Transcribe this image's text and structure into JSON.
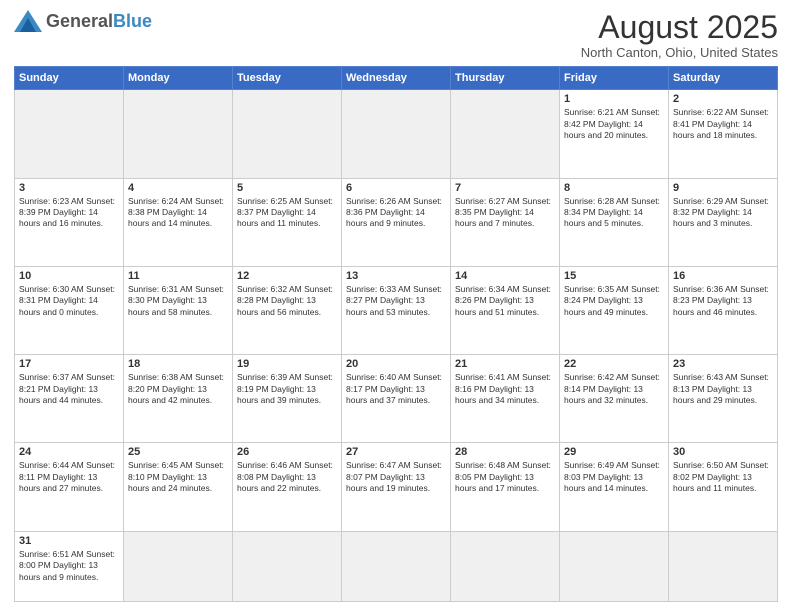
{
  "header": {
    "logo_general": "General",
    "logo_blue": "Blue",
    "month_title": "August 2025",
    "location": "North Canton, Ohio, United States"
  },
  "days_of_week": [
    "Sunday",
    "Monday",
    "Tuesday",
    "Wednesday",
    "Thursday",
    "Friday",
    "Saturday"
  ],
  "weeks": [
    [
      {
        "day": "",
        "info": ""
      },
      {
        "day": "",
        "info": ""
      },
      {
        "day": "",
        "info": ""
      },
      {
        "day": "",
        "info": ""
      },
      {
        "day": "",
        "info": ""
      },
      {
        "day": "1",
        "info": "Sunrise: 6:21 AM\nSunset: 8:42 PM\nDaylight: 14 hours and 20 minutes."
      },
      {
        "day": "2",
        "info": "Sunrise: 6:22 AM\nSunset: 8:41 PM\nDaylight: 14 hours and 18 minutes."
      }
    ],
    [
      {
        "day": "3",
        "info": "Sunrise: 6:23 AM\nSunset: 8:39 PM\nDaylight: 14 hours and 16 minutes."
      },
      {
        "day": "4",
        "info": "Sunrise: 6:24 AM\nSunset: 8:38 PM\nDaylight: 14 hours and 14 minutes."
      },
      {
        "day": "5",
        "info": "Sunrise: 6:25 AM\nSunset: 8:37 PM\nDaylight: 14 hours and 11 minutes."
      },
      {
        "day": "6",
        "info": "Sunrise: 6:26 AM\nSunset: 8:36 PM\nDaylight: 14 hours and 9 minutes."
      },
      {
        "day": "7",
        "info": "Sunrise: 6:27 AM\nSunset: 8:35 PM\nDaylight: 14 hours and 7 minutes."
      },
      {
        "day": "8",
        "info": "Sunrise: 6:28 AM\nSunset: 8:34 PM\nDaylight: 14 hours and 5 minutes."
      },
      {
        "day": "9",
        "info": "Sunrise: 6:29 AM\nSunset: 8:32 PM\nDaylight: 14 hours and 3 minutes."
      }
    ],
    [
      {
        "day": "10",
        "info": "Sunrise: 6:30 AM\nSunset: 8:31 PM\nDaylight: 14 hours and 0 minutes."
      },
      {
        "day": "11",
        "info": "Sunrise: 6:31 AM\nSunset: 8:30 PM\nDaylight: 13 hours and 58 minutes."
      },
      {
        "day": "12",
        "info": "Sunrise: 6:32 AM\nSunset: 8:28 PM\nDaylight: 13 hours and 56 minutes."
      },
      {
        "day": "13",
        "info": "Sunrise: 6:33 AM\nSunset: 8:27 PM\nDaylight: 13 hours and 53 minutes."
      },
      {
        "day": "14",
        "info": "Sunrise: 6:34 AM\nSunset: 8:26 PM\nDaylight: 13 hours and 51 minutes."
      },
      {
        "day": "15",
        "info": "Sunrise: 6:35 AM\nSunset: 8:24 PM\nDaylight: 13 hours and 49 minutes."
      },
      {
        "day": "16",
        "info": "Sunrise: 6:36 AM\nSunset: 8:23 PM\nDaylight: 13 hours and 46 minutes."
      }
    ],
    [
      {
        "day": "17",
        "info": "Sunrise: 6:37 AM\nSunset: 8:21 PM\nDaylight: 13 hours and 44 minutes."
      },
      {
        "day": "18",
        "info": "Sunrise: 6:38 AM\nSunset: 8:20 PM\nDaylight: 13 hours and 42 minutes."
      },
      {
        "day": "19",
        "info": "Sunrise: 6:39 AM\nSunset: 8:19 PM\nDaylight: 13 hours and 39 minutes."
      },
      {
        "day": "20",
        "info": "Sunrise: 6:40 AM\nSunset: 8:17 PM\nDaylight: 13 hours and 37 minutes."
      },
      {
        "day": "21",
        "info": "Sunrise: 6:41 AM\nSunset: 8:16 PM\nDaylight: 13 hours and 34 minutes."
      },
      {
        "day": "22",
        "info": "Sunrise: 6:42 AM\nSunset: 8:14 PM\nDaylight: 13 hours and 32 minutes."
      },
      {
        "day": "23",
        "info": "Sunrise: 6:43 AM\nSunset: 8:13 PM\nDaylight: 13 hours and 29 minutes."
      }
    ],
    [
      {
        "day": "24",
        "info": "Sunrise: 6:44 AM\nSunset: 8:11 PM\nDaylight: 13 hours and 27 minutes."
      },
      {
        "day": "25",
        "info": "Sunrise: 6:45 AM\nSunset: 8:10 PM\nDaylight: 13 hours and 24 minutes."
      },
      {
        "day": "26",
        "info": "Sunrise: 6:46 AM\nSunset: 8:08 PM\nDaylight: 13 hours and 22 minutes."
      },
      {
        "day": "27",
        "info": "Sunrise: 6:47 AM\nSunset: 8:07 PM\nDaylight: 13 hours and 19 minutes."
      },
      {
        "day": "28",
        "info": "Sunrise: 6:48 AM\nSunset: 8:05 PM\nDaylight: 13 hours and 17 minutes."
      },
      {
        "day": "29",
        "info": "Sunrise: 6:49 AM\nSunset: 8:03 PM\nDaylight: 13 hours and 14 minutes."
      },
      {
        "day": "30",
        "info": "Sunrise: 6:50 AM\nSunset: 8:02 PM\nDaylight: 13 hours and 11 minutes."
      }
    ],
    [
      {
        "day": "31",
        "info": "Sunrise: 6:51 AM\nSunset: 8:00 PM\nDaylight: 13 hours and 9 minutes."
      },
      {
        "day": "",
        "info": ""
      },
      {
        "day": "",
        "info": ""
      },
      {
        "day": "",
        "info": ""
      },
      {
        "day": "",
        "info": ""
      },
      {
        "day": "",
        "info": ""
      },
      {
        "day": "",
        "info": ""
      }
    ]
  ]
}
